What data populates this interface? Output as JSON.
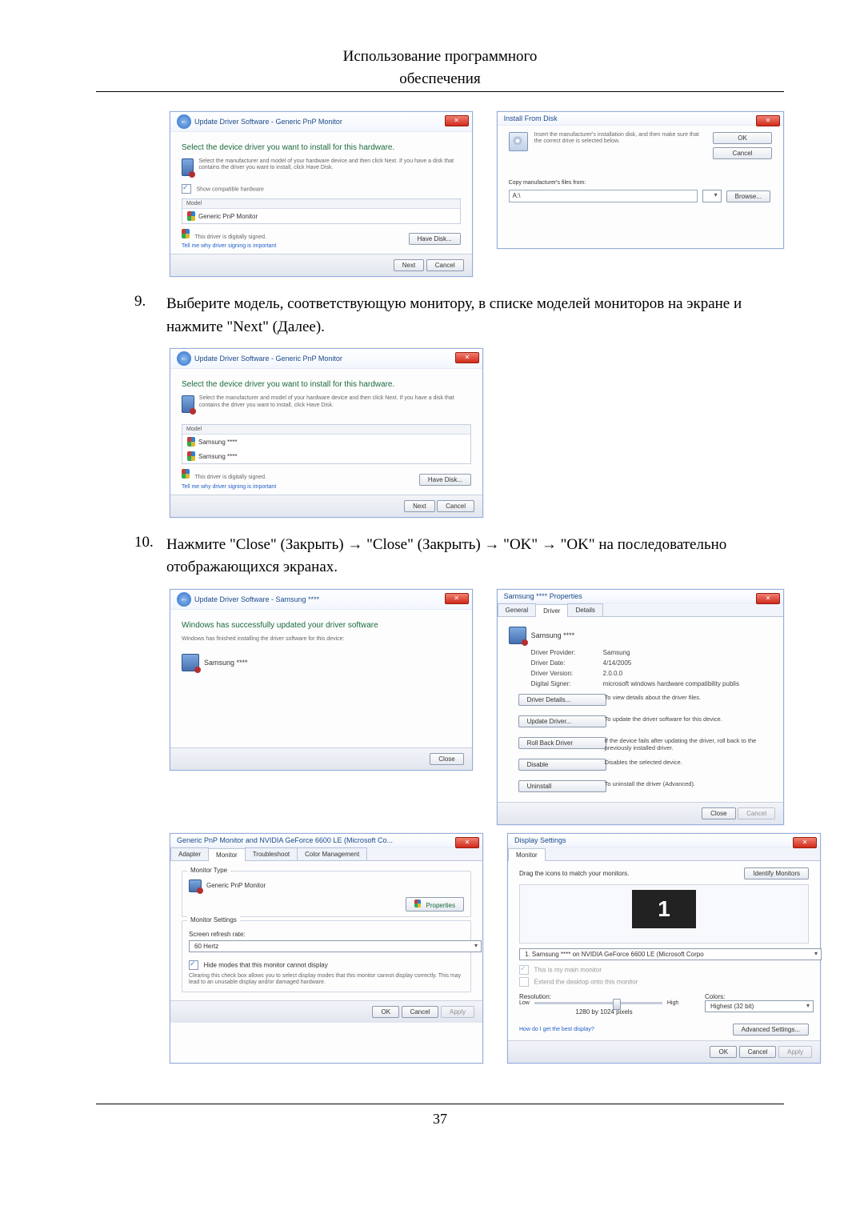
{
  "header": {
    "line1": "Использование программного",
    "line2": "обеспечения"
  },
  "steps": {
    "s9": {
      "num": "9.",
      "text": "Выберите модель, соответствующую монитору, в списке моделей мониторов на экране и нажмите \"Next\" (Далее)."
    },
    "s10": {
      "num": "10.",
      "text": "Нажмите \"Close\" (Закрыть) → \"Close\" (Закрыть) → \"OK\" → \"OK\" на последовательно отображающихся экранах."
    }
  },
  "dlg_update1": {
    "title": "Update Driver Software - Generic PnP Monitor",
    "heading": "Select the device driver you want to install for this hardware.",
    "desc": "Select the manufacturer and model of your hardware device and then click Next. If you have a disk that contains the driver you want to install, click Have Disk.",
    "chk_label": "Show compatible hardware",
    "col": "Model",
    "row": "Generic PnP Monitor",
    "signed": "This driver is digitally signed.",
    "tell": "Tell me why driver signing is important",
    "havedisk": "Have Disk...",
    "next": "Next",
    "cancel": "Cancel"
  },
  "dlg_install": {
    "title": "Install From Disk",
    "desc": "Insert the manufacturer's installation disk, and then make sure that the correct drive is selected below.",
    "ok": "OK",
    "cancel": "Cancel",
    "copy": "Copy manufacturer's files from:",
    "path": "A:\\",
    "browse": "Browse..."
  },
  "dlg_update2": {
    "title": "Update Driver Software - Generic PnP Monitor",
    "heading": "Select the device driver you want to install for this hardware.",
    "desc": "Select the manufacturer and model of your hardware device and then click Next. If you have a disk that contains the driver you want to install, click Have Disk.",
    "col": "Model",
    "row1": "Samsung ****",
    "row2": "Samsung ****",
    "signed": "This driver is digitally signed.",
    "tell": "Tell me why driver signing is important",
    "havedisk": "Have Disk...",
    "next": "Next",
    "cancel": "Cancel"
  },
  "dlg_done": {
    "title": "Update Driver Software - Samsung ****",
    "heading": "Windows has successfully updated your driver software",
    "sub": "Windows has finished installing the driver software for this device:",
    "device": "Samsung ****",
    "close": "Close"
  },
  "dlg_props": {
    "title": "Samsung **** Properties",
    "tabs": {
      "general": "General",
      "driver": "Driver",
      "details": "Details"
    },
    "device": "Samsung ****",
    "kv": {
      "prov_l": "Driver Provider:",
      "prov_v": "Samsung",
      "date_l": "Driver Date:",
      "date_v": "4/14/2005",
      "ver_l": "Driver Version:",
      "ver_v": "2.0.0.0",
      "sig_l": "Digital Signer:",
      "sig_v": "microsoft windows hardware compatibility publis"
    },
    "btns": {
      "details": "Driver Details...",
      "details_d": "To view details about the driver files.",
      "update": "Update Driver...",
      "update_d": "To update the driver software for this device.",
      "roll": "Roll Back Driver",
      "roll_d": "If the device fails after updating the driver, roll back to the previously installed driver.",
      "disable": "Disable",
      "disable_d": "Disables the selected device.",
      "uninstall": "Uninstall",
      "uninstall_d": "To uninstall the driver (Advanced)."
    },
    "close": "Close",
    "cancel": "Cancel"
  },
  "dlg_generic": {
    "title": "Generic PnP Monitor and NVIDIA GeForce 6600 LE (Microsoft Co...",
    "tabs": {
      "adapter": "Adapter",
      "monitor": "Monitor",
      "troubleshoot": "Troubleshoot",
      "color": "Color Management"
    },
    "mtype_title": "Monitor Type",
    "mtype": "Generic PnP Monitor",
    "props": "Properties",
    "msettings_title": "Monitor Settings",
    "refresh_l": "Screen refresh rate:",
    "refresh_v": "60 Hertz",
    "hide": "Hide modes that this monitor cannot display",
    "hide_desc": "Clearing this check box allows you to select display modes that this monitor cannot display correctly. This may lead to an unusable display and/or damaged hardware.",
    "ok": "OK",
    "cancel": "Cancel",
    "apply": "Apply"
  },
  "dlg_display": {
    "title": "Display Settings",
    "tab": "Monitor",
    "drag": "Drag the icons to match your monitors.",
    "identify": "Identify Monitors",
    "mon_num": "1",
    "mon_dd": "1. Samsung **** on NVIDIA GeForce 6600 LE (Microsoft Corpo",
    "main": "This is my main monitor",
    "extend": "Extend the desktop onto this monitor",
    "res_l": "Resolution:",
    "low": "Low",
    "high": "High",
    "res_v": "1280 by 1024 pixels",
    "col_l": "Colors:",
    "col_v": "Highest (32 bit)",
    "best": "How do I get the best display?",
    "adv": "Advanced Settings...",
    "ok": "OK",
    "cancel": "Cancel",
    "apply": "Apply"
  },
  "footer": "37"
}
